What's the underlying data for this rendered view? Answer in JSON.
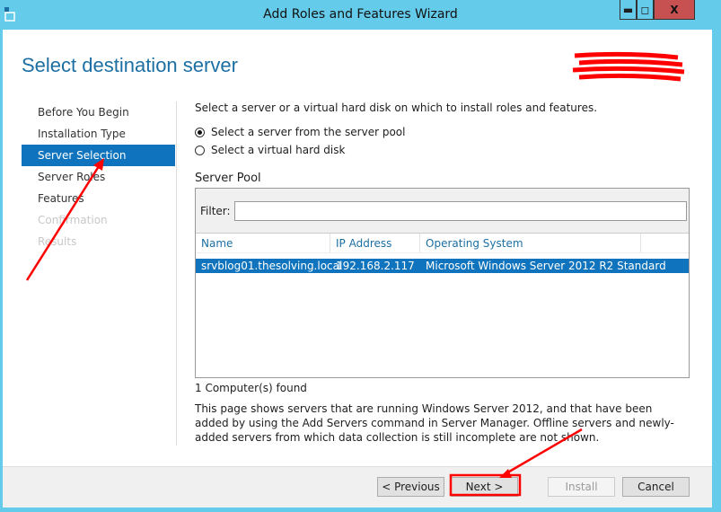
{
  "window": {
    "title": "Add Roles and Features Wizard",
    "minimize": "▬",
    "maximize": "◻",
    "close": "X"
  },
  "page_title": "Select destination server",
  "nav": [
    {
      "label": "Before You Begin",
      "state": "normal"
    },
    {
      "label": "Installation Type",
      "state": "normal"
    },
    {
      "label": "Server Selection",
      "state": "selected"
    },
    {
      "label": "Server Roles",
      "state": "normal"
    },
    {
      "label": "Features",
      "state": "normal"
    },
    {
      "label": "Confirmation",
      "state": "disabled"
    },
    {
      "label": "Results",
      "state": "disabled"
    }
  ],
  "main": {
    "instruction": "Select a server or a virtual hard disk on which to install roles and features.",
    "radio_pool": "Select a server from the server pool",
    "radio_vhd": "Select a virtual hard disk",
    "selected_option": "server pool",
    "pool_label": "Server Pool",
    "filter_label": "Filter:",
    "filter_value": "",
    "columns": [
      "Name",
      "IP Address",
      "Operating System"
    ],
    "rows": [
      {
        "name": "srvblog01.thesolving.local",
        "ip": "192.168.2.117",
        "os": "Microsoft Windows Server 2012 R2 Standard"
      }
    ],
    "found": "1 Computer(s) found",
    "description": "This page shows servers that are running Windows Server 2012, and that have been added by using the Add Servers command in Server Manager. Offline servers and newly-added servers from which data collection is still incomplete are not shown."
  },
  "buttons": {
    "previous": "< Previous",
    "next": "Next >",
    "install": "Install",
    "cancel": "Cancel"
  },
  "colors": {
    "accent": "#0f74bd",
    "titlebar": "#65cbea",
    "annotation": "#ff0000"
  }
}
